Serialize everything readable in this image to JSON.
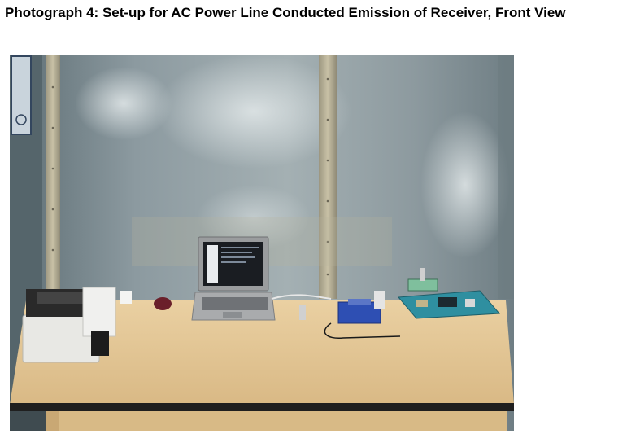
{
  "document": {
    "caption": "Photograph 4: Set-up for AC Power Line Conducted Emission of Receiver, Front View"
  },
  "photo": {
    "palette": {
      "wall": "#8e9ca2",
      "wall_highlight": "#c9d2d4",
      "strip": "#b8b29a",
      "table_top": "#e6c999",
      "table_edge": "#1f1f1f",
      "floor": "#5f6d73",
      "printer": "#e8e8e4",
      "laptop": "#9a9c9e",
      "board": "#2f8fa0",
      "blue_box": "#2e4fb3"
    }
  }
}
